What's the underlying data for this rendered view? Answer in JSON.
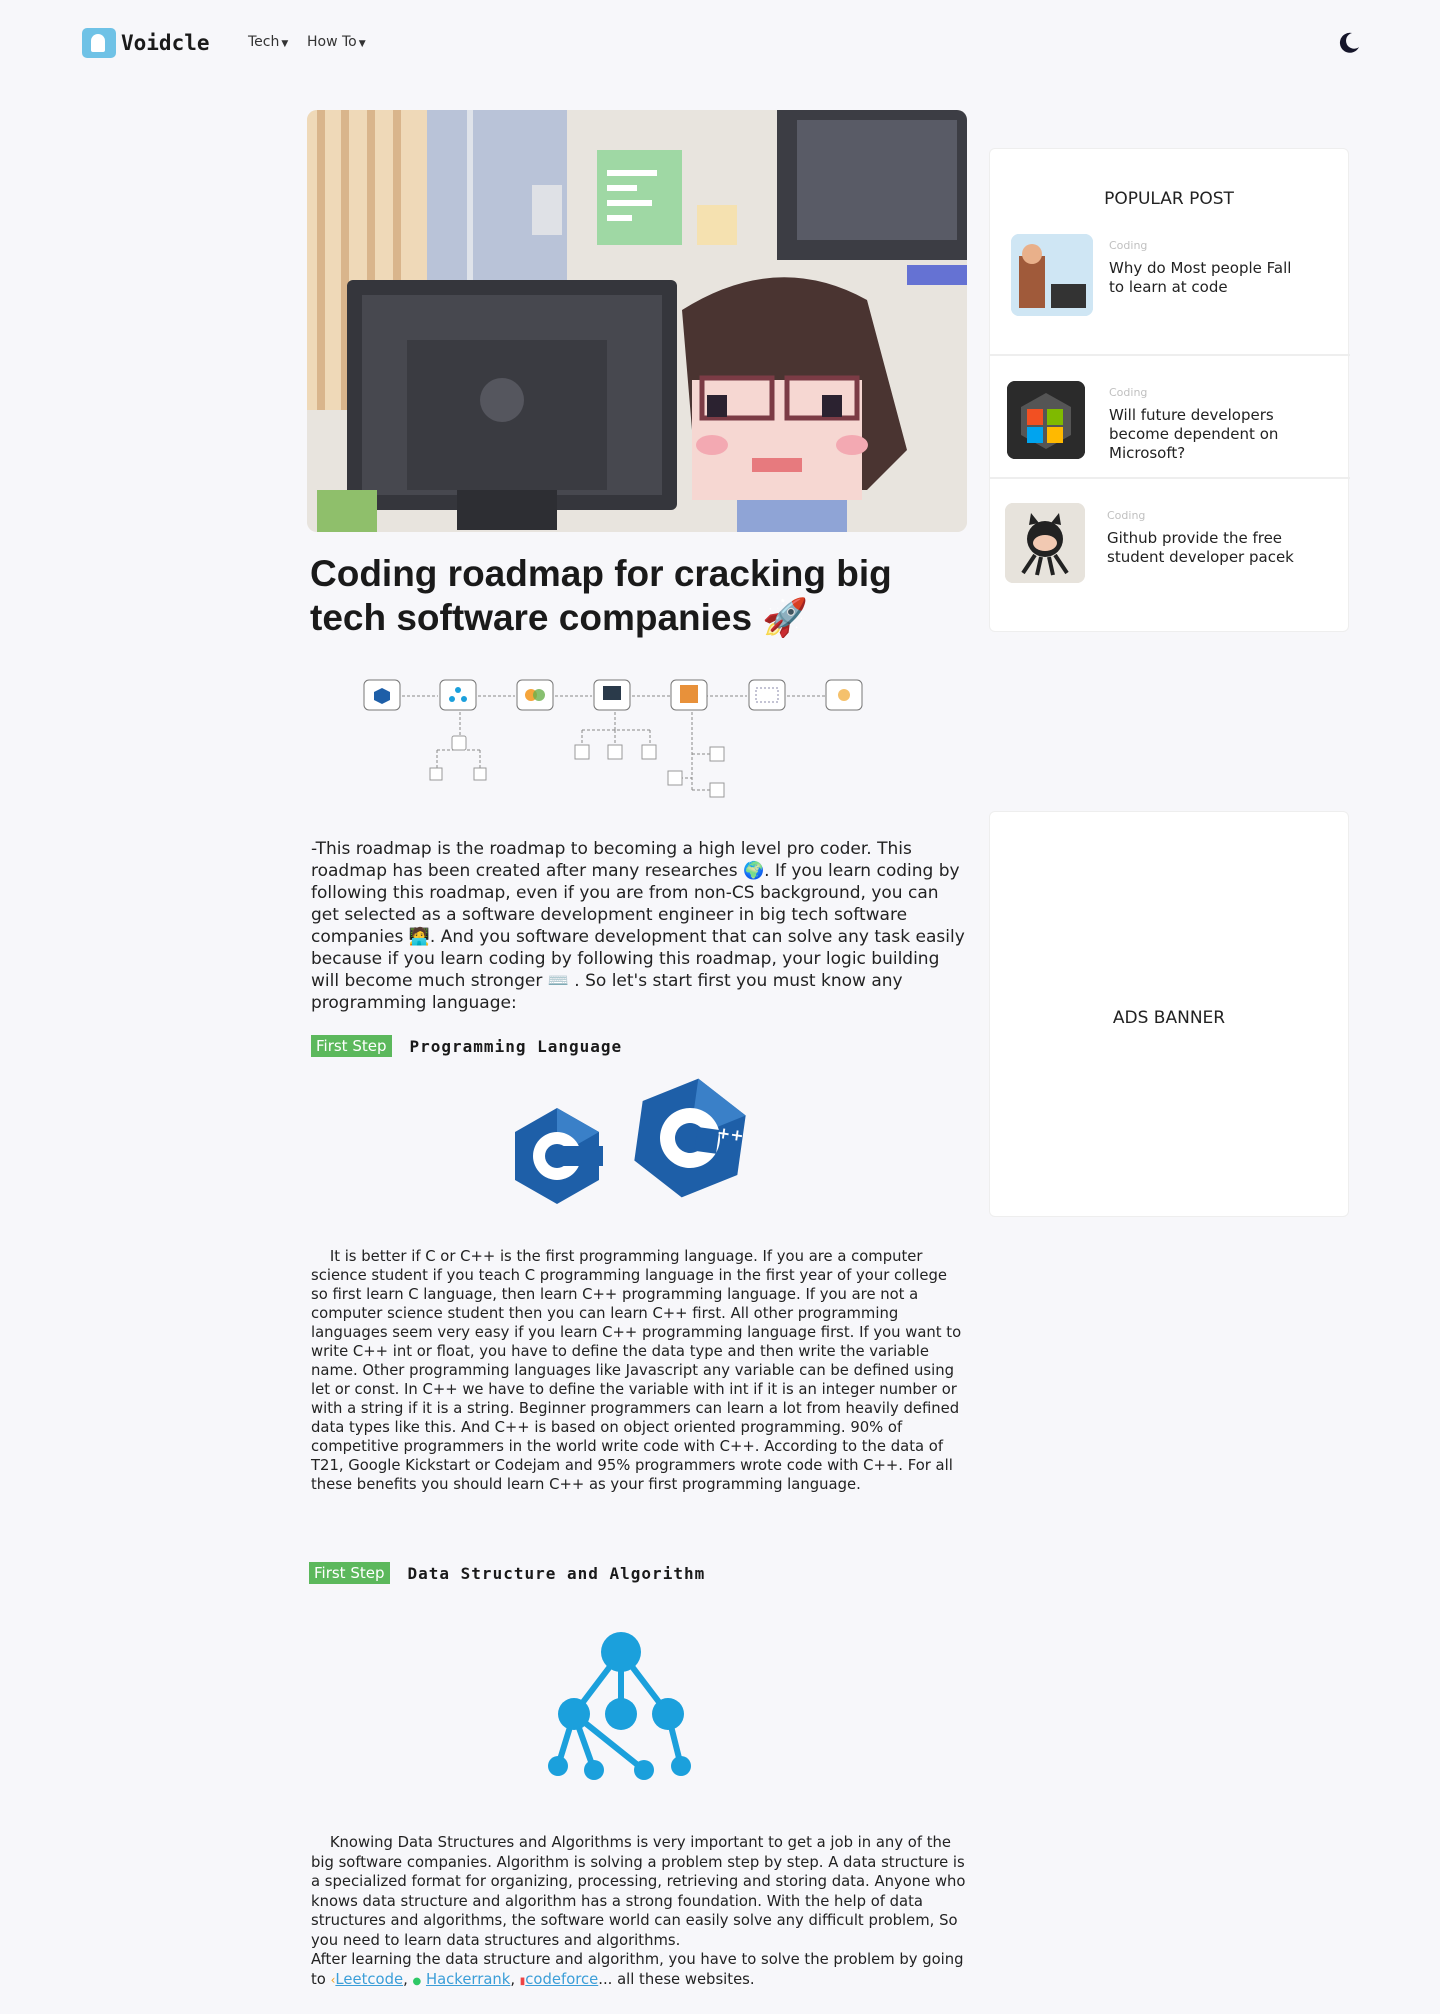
{
  "header": {
    "logo_text": "Voidcle",
    "nav": [
      {
        "label": "Tech"
      },
      {
        "label": "How To"
      }
    ],
    "theme_icon": "moon-icon"
  },
  "article": {
    "title": "Coding roadmap for cracking big tech software companies 🚀",
    "intro": "-This roadmap is the roadmap to becoming a high level pro coder. This roadmap has been created after many researches 🌍. If you learn coding by following this roadmap, even if you are from non-CS background, you can get selected as a software  development engineer in big tech software companies 🧑‍💻. And you software development that can solve any task easily because if you learn coding by following this roadmap, your logic building will become much stronger ⌨️ . So let's start first you must know any programming language:",
    "steps": [
      {
        "badge": "First Step",
        "title": "Programming Language",
        "text": "It is better if C or C++ is the first programming language. If you are a computer science student if you teach C programming language in the first year of your college so first learn C language, then learn C++ programming language. If you are not a computer science student then you can learn C++ first. All other programming languages seem very easy if you learn C++ programming language first. If you want to write C++ int or float, you have to define the data type and then write the variable name. Other programming languages like Javascript any variable can be defined using let or const. In C++ we have to define the variable with int if it is an integer number or with a string if it is a string. Beginner programmers can learn a lot from heavily defined data types like this. And C++ is based on object oriented programming. 90% of competitive programmers in the world write code with C++. According to the data of T21, Google Kickstart or Codejam and 95% programmers wrote code with C++. For all these benefits you should learn C++ as your first programming language."
      },
      {
        "badge": "First Step",
        "title": "Data Structure and Algorithm",
        "text": "Knowing Data Structures and Algorithms is very important to get a job in any of the big software companies. Algorithm is solving a problem step by step. A data structure is a specialized format for organizing, processing, retrieving and storing data. Anyone who knows data structure and algorithm has a strong foundation. With the help of data structures and algorithms, the software world can easily solve any difficult problem, So you need to learn data structures and algorithms.",
        "text2_pre": "After learning the data structure and algorithm, you have to solve the problem by going to",
        "links": [
          "Leetcode",
          "Hackerrank",
          "codeforce"
        ],
        "text2_post": "... all these websites."
      }
    ]
  },
  "sidebar": {
    "popular_title": "POPULAR POST",
    "posts": [
      {
        "category": "Coding",
        "title": "Why do Most people Fall to learn at code"
      },
      {
        "category": "Coding",
        "title": "Will future developers become dependent on Microsoft?"
      },
      {
        "category": "Coding",
        "title": "Github provide the free student developer pacek"
      }
    ],
    "ads_text": "ADS BANNER"
  },
  "colors": {
    "badge": "#5cb85c",
    "link": "#3b9ed8",
    "c_blue": "#1e5fa8",
    "dsa_blue": "#1ba0dc"
  }
}
